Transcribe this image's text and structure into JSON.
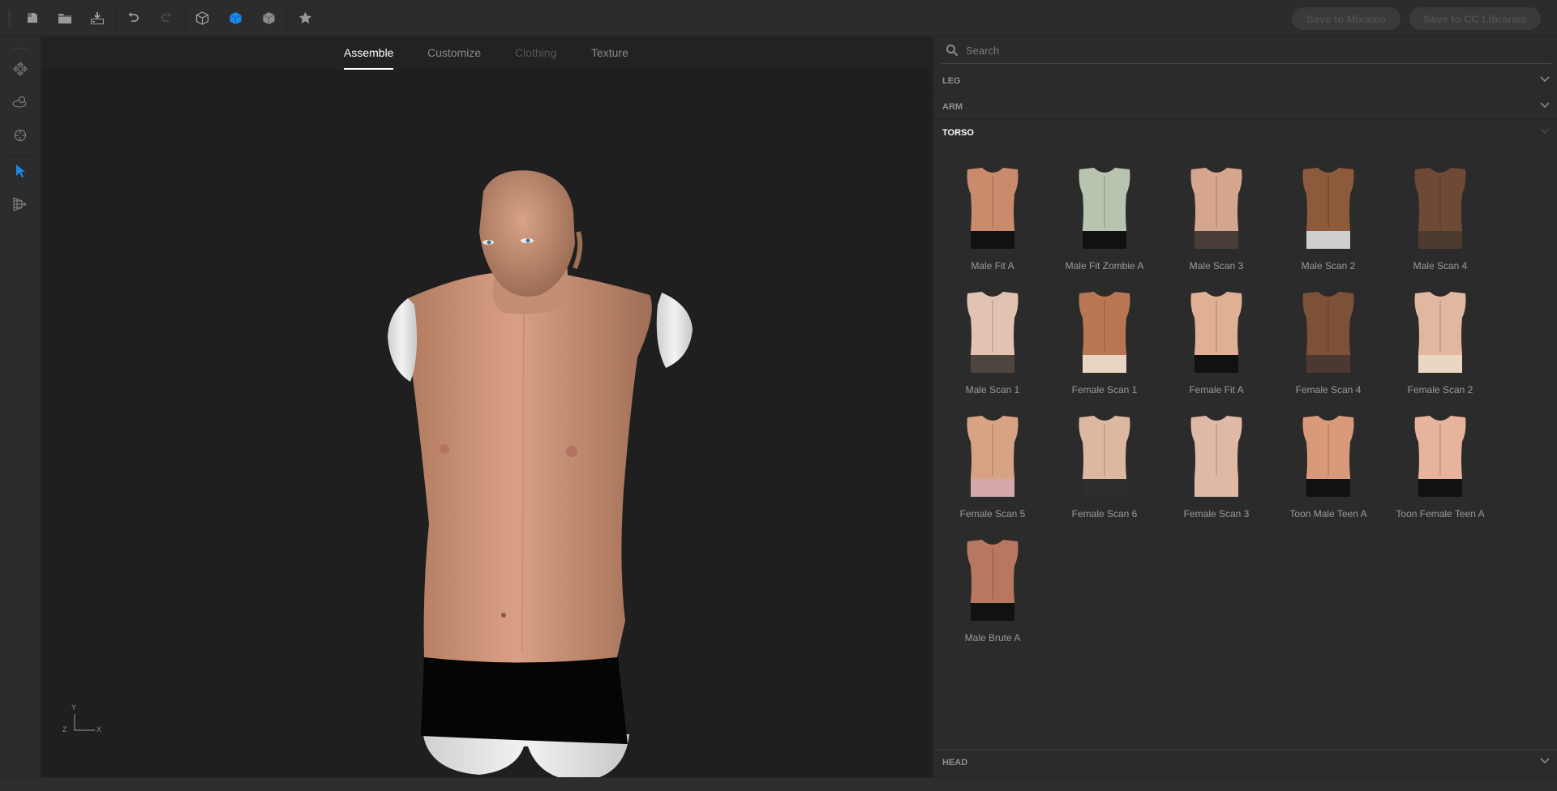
{
  "toolbar": {
    "buttons": [
      {
        "id": "new",
        "icon": "new-file-icon",
        "label": "New"
      },
      {
        "id": "open",
        "icon": "folder-icon",
        "label": "Open"
      },
      {
        "id": "import",
        "icon": "import-icon",
        "label": "Import"
      },
      {
        "id": "undo",
        "icon": "undo-icon",
        "label": "Undo"
      },
      {
        "id": "redo",
        "icon": "redo-icon",
        "label": "Redo"
      },
      {
        "id": "view-wire",
        "icon": "cube-outline-icon",
        "label": "Wireframe"
      },
      {
        "id": "view-solid",
        "icon": "cube-solid-icon",
        "label": "Solid"
      },
      {
        "id": "view-shaded",
        "icon": "cube-shaded-icon",
        "label": "Shaded"
      },
      {
        "id": "favorite",
        "icon": "star-icon",
        "label": "Favorite"
      }
    ],
    "save_mixamo_label": "Save to Mixamo",
    "save_cc_label": "Save to CC Libraries",
    "accent_color": "#1a8ae8"
  },
  "tools": [
    {
      "icon": "move-icon",
      "label": "Pan"
    },
    {
      "icon": "orbit-icon",
      "label": "Orbit"
    },
    {
      "icon": "target-icon",
      "label": "Focus"
    },
    {
      "icon": "pointer-icon",
      "label": "Select",
      "active": true
    },
    {
      "icon": "perspective-icon",
      "label": "Perspective"
    }
  ],
  "viewport": {
    "tabs": [
      {
        "label": "Assemble",
        "state": "active"
      },
      {
        "label": "Customize",
        "state": "normal"
      },
      {
        "label": "Clothing",
        "state": "disabled"
      },
      {
        "label": "Texture",
        "state": "normal"
      }
    ],
    "axis": {
      "y": "Y",
      "z": "Z",
      "x": "X"
    }
  },
  "panel": {
    "search_placeholder": "Search",
    "sections": [
      {
        "label": "LEG",
        "open": false
      },
      {
        "label": "ARM",
        "open": false
      },
      {
        "label": "TORSO",
        "open": true
      },
      {
        "label": "HEAD",
        "open": false
      }
    ],
    "torso_items": [
      {
        "name": "Male Fit A",
        "skin": "#c98b6b",
        "bottom": "#111111"
      },
      {
        "name": "Male Fit Zombie A",
        "skin": "#b9c4b0",
        "bottom": "#111111"
      },
      {
        "name": "Male Scan 3",
        "skin": "#d6a58e",
        "bottom": "#4a3f38"
      },
      {
        "name": "Male Scan 2",
        "skin": "#8e5a3c",
        "bottom": "#cfcfcf"
      },
      {
        "name": "Male Scan 4",
        "skin": "#6e4a36",
        "bottom": "#4d3b30"
      },
      {
        "name": "Male Scan 1",
        "skin": "#e2c3b2",
        "bottom": "#4f453f"
      },
      {
        "name": "Female Scan 1",
        "skin": "#b87752",
        "bottom": "#e8d5c2"
      },
      {
        "name": "Female Fit A",
        "skin": "#e0b095",
        "bottom": "#111111"
      },
      {
        "name": "Female Scan 4",
        "skin": "#7d5038",
        "bottom": "#4b3830"
      },
      {
        "name": "Female Scan 2",
        "skin": "#e2b7a0",
        "bottom": "#ead7c2"
      },
      {
        "name": "Female Scan 5",
        "skin": "#d7a383",
        "bottom": "#d4a8a8"
      },
      {
        "name": "Female Scan 6",
        "skin": "#dcb7a2",
        "bottom": "#2d2d2d"
      },
      {
        "name": "Female Scan 3",
        "skin": "#dfb9a5",
        "bottom": "#dfb9a5"
      },
      {
        "name": "Toon Male Teen A",
        "skin": "#d99a7b",
        "bottom": "#111111"
      },
      {
        "name": "Toon Female Teen A",
        "skin": "#e7b39b",
        "bottom": "#111111"
      },
      {
        "name": "Male Brute A",
        "skin": "#b87860",
        "bottom": "#111111"
      }
    ]
  }
}
